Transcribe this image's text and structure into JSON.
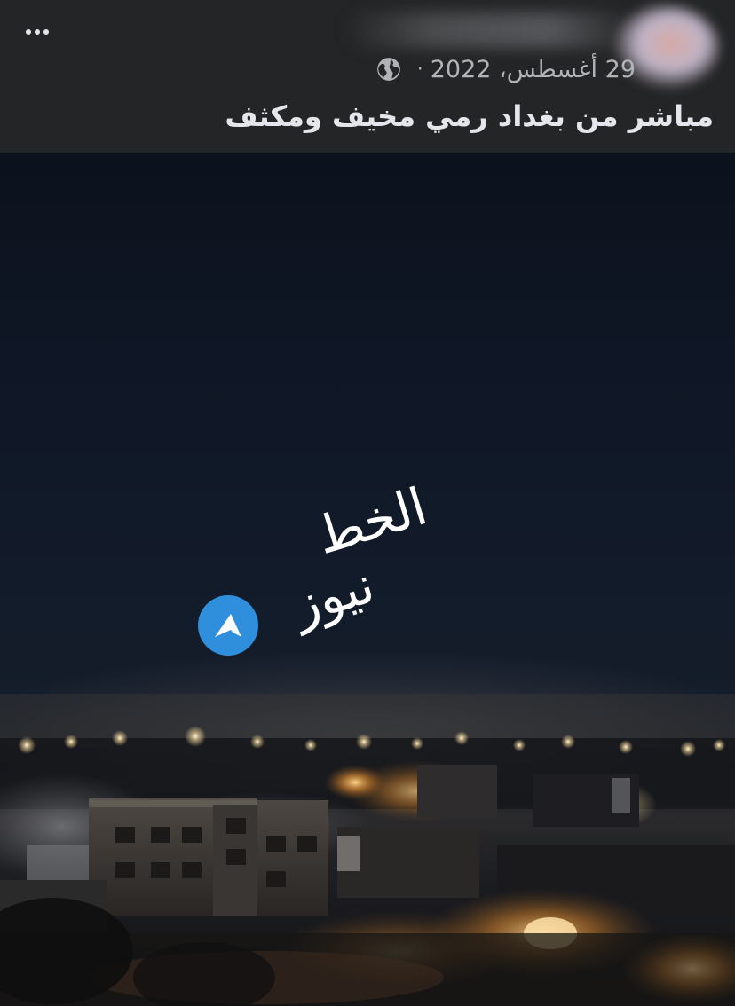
{
  "header": {
    "date_text": "29 أغسطس، 2022",
    "separator": "·",
    "privacy_icon": "globe-icon",
    "more_icon": "more-dots-icon"
  },
  "post": {
    "text": "مباشر من بغداد رمي مخيف ومكثف"
  },
  "video": {
    "watermark_line1": "الخط",
    "watermark_line2": "نيوز",
    "watermark_icon": "telegram-icon"
  },
  "colors": {
    "header_bg": "#242526",
    "primary_text": "#e4e6eb",
    "secondary_text": "#b0b3b8",
    "telegram_blue": "#2f8fdc"
  }
}
